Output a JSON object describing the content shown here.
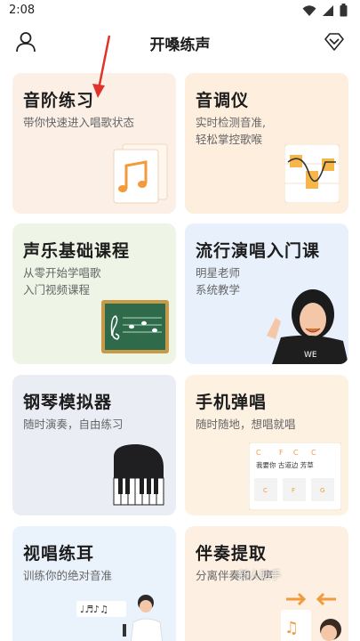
{
  "status": {
    "time": "2:08"
  },
  "header": {
    "title": "开嗓练声"
  },
  "cards": [
    {
      "title": "音阶练习",
      "sub": "带你快速进入唱歌状态"
    },
    {
      "title": "音调仪",
      "sub": "实时检测音准,\n轻松掌控歌喉"
    },
    {
      "title": "声乐基础课程",
      "sub": "从零开始学唱歌\n入门视频课程"
    },
    {
      "title": "流行演唱入门课",
      "sub": "明星老师\n系统教学"
    },
    {
      "title": "钢琴模拟器",
      "sub": "随时演奏，自由练习"
    },
    {
      "title": "手机弹唱",
      "sub": "随时随地，想唱就唱"
    },
    {
      "title": "视唱练耳",
      "sub": "训练你的绝对音准"
    },
    {
      "title": "伴奏提取",
      "sub": "分离伴奏和人声"
    }
  ],
  "piano_card_chords": {
    "top": "C      F    C     C",
    "lyrics": "我要你  在身边  芳草"
  },
  "watermark": "新人助手",
  "colors": {
    "accent_red": "#e0342b",
    "orange": "#f39a3c"
  }
}
